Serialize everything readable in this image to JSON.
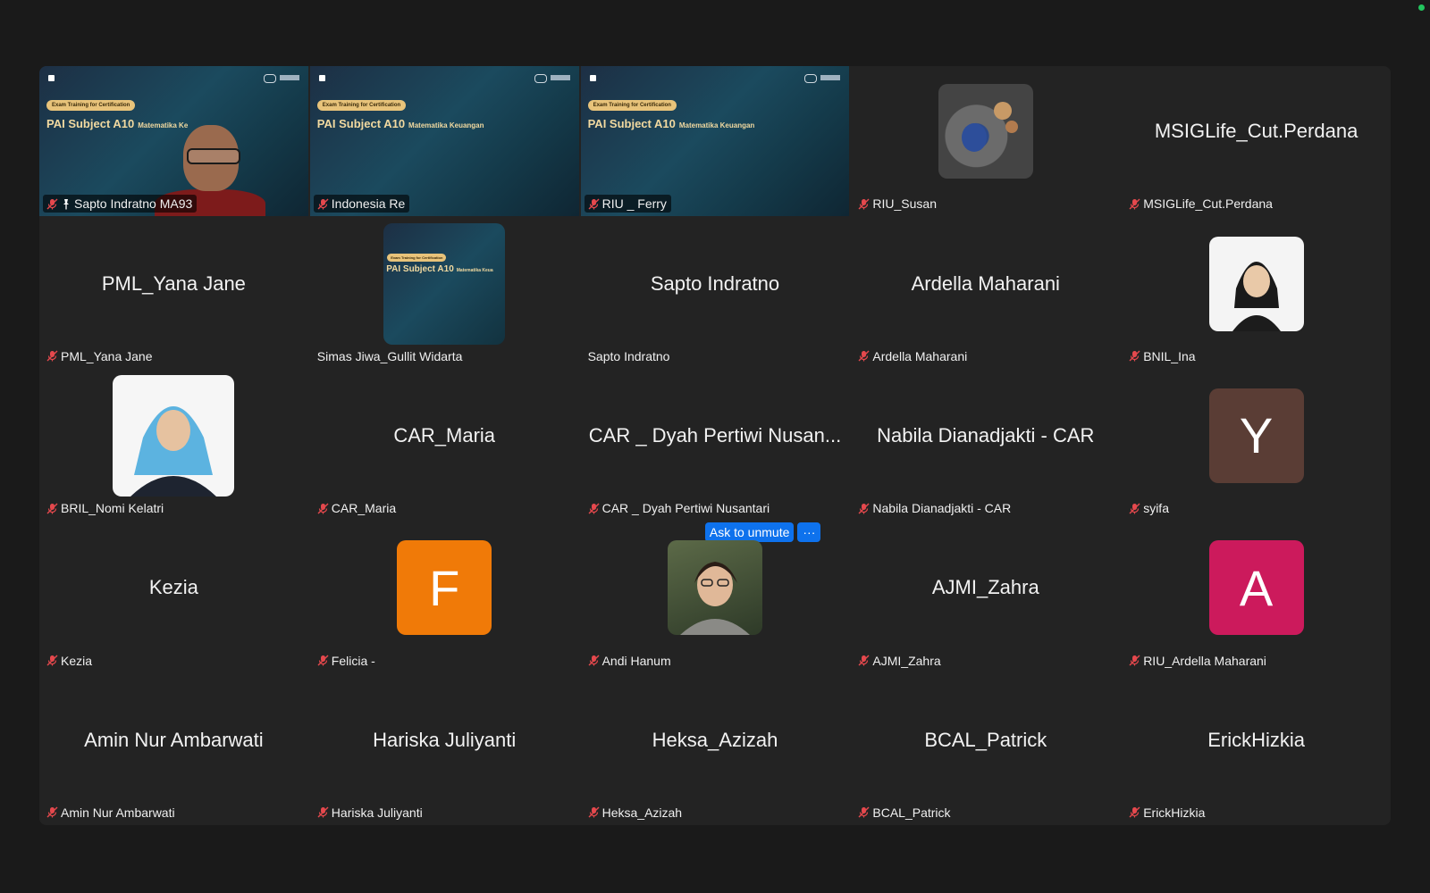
{
  "slide": {
    "badge": "Exam Training for Certification",
    "title": "PAI Subject A10",
    "subtitle": "Matematika Keuangan",
    "subtitle_cut": "Matematika Ke",
    "mini_subtitle": "Matematika Keua"
  },
  "ask_unmute": {
    "label": "Ask to unmute",
    "more": "···"
  },
  "colors": {
    "muted": "#e5484d",
    "accent": "#0e72ed",
    "avatar_y": "#5a3d35",
    "avatar_f": "#f07a08",
    "avatar_a": "#cc1a5c"
  },
  "tiles": [
    {
      "name": "Sapto Indratno MA93"
    },
    {
      "name": "Indonesia Re"
    },
    {
      "name": "RIU _ Ferry"
    },
    {
      "name": "RIU_Susan"
    },
    {
      "name": "MSIGLife_Cut.Perdana",
      "display": "MSIGLife_Cut.Perdana"
    },
    {
      "name": "PML_Yana Jane",
      "display": "PML_Yana Jane"
    },
    {
      "name": "Simas Jiwa_Gullit Widarta"
    },
    {
      "name": "Sapto Indratno",
      "display": "Sapto Indratno"
    },
    {
      "name": "Ardella Maharani",
      "display": "Ardella Maharani"
    },
    {
      "name": "BNIL_Ina"
    },
    {
      "name": "BRIL_Nomi Kelatri"
    },
    {
      "name": "CAR_Maria",
      "display": "CAR_Maria"
    },
    {
      "name": "CAR _ Dyah Pertiwi Nusantari",
      "display": "CAR _ Dyah Pertiwi Nusan..."
    },
    {
      "name": "Nabila Dianadjakti - CAR",
      "display": "Nabila Dianadjakti - CAR"
    },
    {
      "name": "syifa",
      "initial": "Y"
    },
    {
      "name": "Kezia",
      "display": "Kezia"
    },
    {
      "name": "Felicia -",
      "initial": "F"
    },
    {
      "name": "Andi Hanum"
    },
    {
      "name": "AJMI_Zahra",
      "display": "AJMI_Zahra"
    },
    {
      "name": "RIU_Ardella Maharani",
      "initial": "A"
    },
    {
      "name": "Amin Nur Ambarwati",
      "display": "Amin Nur Ambarwati"
    },
    {
      "name": "Hariska Juliyanti",
      "display": "Hariska Juliyanti"
    },
    {
      "name": "Heksa_Azizah",
      "display": "Heksa_Azizah"
    },
    {
      "name": "BCAL_Patrick",
      "display": "BCAL_Patrick"
    },
    {
      "name": "ErickHizkia",
      "display": "ErickHizkia"
    }
  ]
}
